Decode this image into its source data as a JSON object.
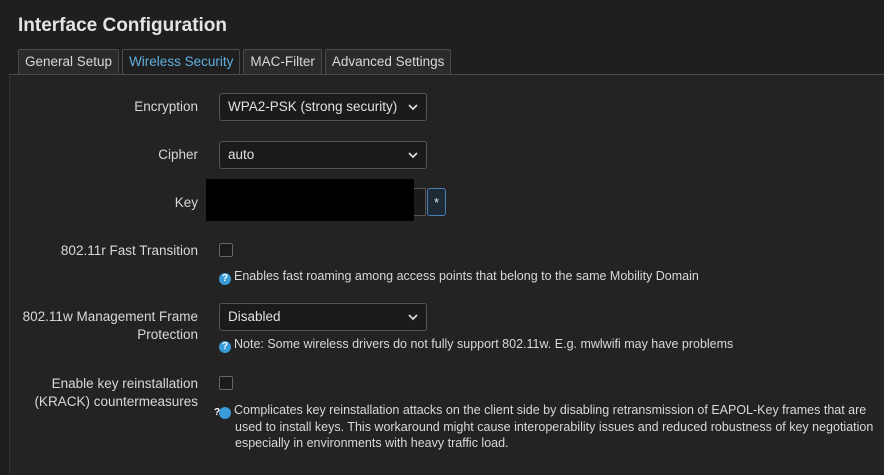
{
  "page": {
    "title": "Interface Configuration"
  },
  "tabs": [
    {
      "label": "General Setup",
      "active": false
    },
    {
      "label": "Wireless Security",
      "active": true
    },
    {
      "label": "MAC-Filter",
      "active": false
    },
    {
      "label": "Advanced Settings",
      "active": false
    }
  ],
  "form": {
    "encryption": {
      "label": "Encryption",
      "value": "WPA2-PSK (strong security)"
    },
    "cipher": {
      "label": "Cipher",
      "value": "auto"
    },
    "key": {
      "label": "Key",
      "reveal_label": "*"
    },
    "fast_transition": {
      "label": "802.11r Fast Transition",
      "checked": false,
      "help": "Enables fast roaming among access points that belong to the same Mobility Domain"
    },
    "mgmt_frame": {
      "label_line1": "802.11w Management Frame",
      "label_line2": "Protection",
      "value": "Disabled",
      "help": "Note: Some wireless drivers do not fully support 802.11w. E.g. mwlwifi may have problems"
    },
    "krack": {
      "label_line1": "Enable key reinstallation",
      "label_line2": "(KRACK) countermeasures",
      "checked": false,
      "help": "Complicates key reinstallation attacks on the client side by disabling retransmission of EAPOL-Key frames that are used to install keys. This workaround might cause interoperability issues and reduced robustness of key negotiation especially in environments with heavy traffic load."
    }
  },
  "icons": {
    "help": "question-circle-icon",
    "dropdown": "chevron-down-icon"
  },
  "colors": {
    "background": "#1f1f1f",
    "active_tab": "#5fb0e0",
    "help_icon": "#3a9bd9",
    "reveal_border": "#4a7fb5"
  }
}
